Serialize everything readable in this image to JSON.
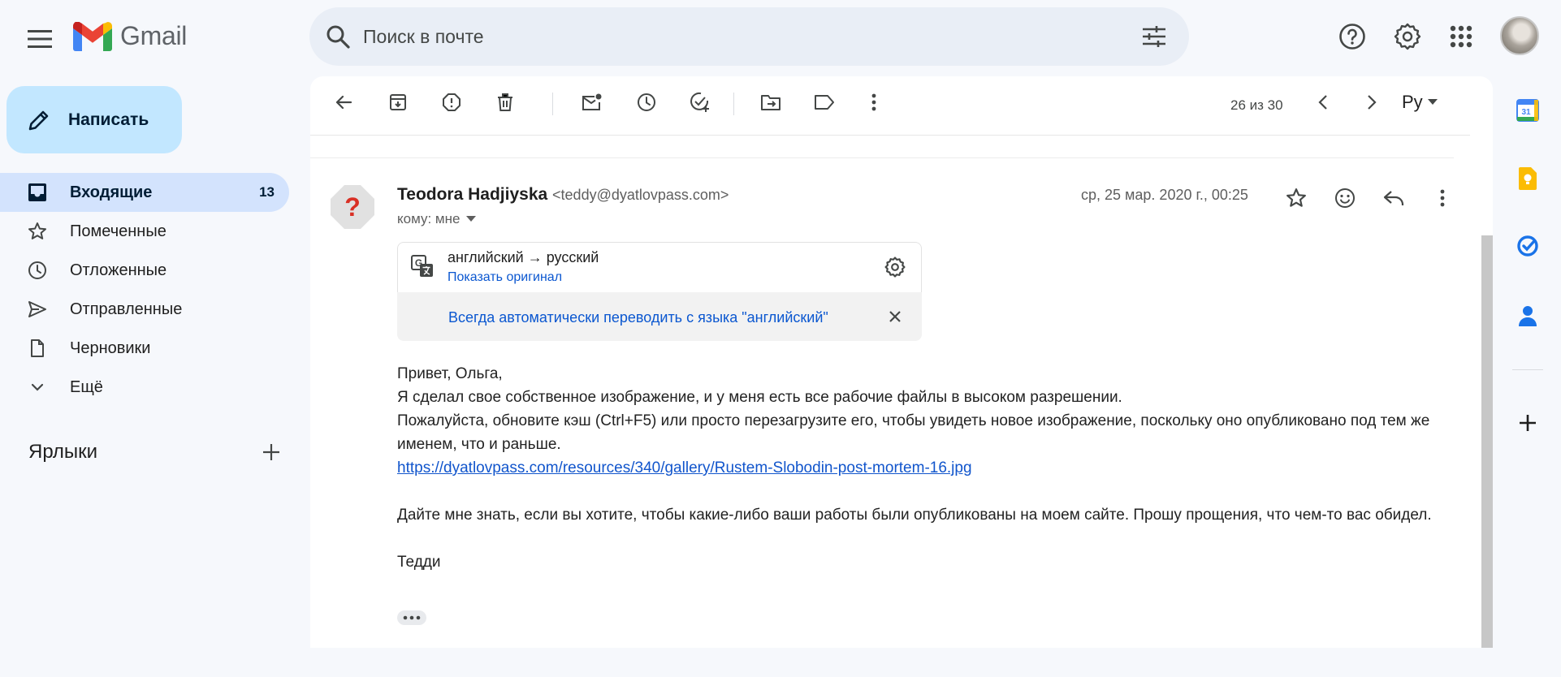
{
  "header": {
    "app_name": "Gmail",
    "search_placeholder": "Поиск в почте"
  },
  "sidebar": {
    "compose_label": "Написать",
    "items": [
      {
        "label": "Входящие",
        "count": "13",
        "icon": "inbox-icon",
        "active": true
      },
      {
        "label": "Помеченные",
        "icon": "star-icon"
      },
      {
        "label": "Отложенные",
        "icon": "clock-icon"
      },
      {
        "label": "Отправленные",
        "icon": "send-icon"
      },
      {
        "label": "Черновики",
        "icon": "draft-icon"
      },
      {
        "label": "Ещё",
        "icon": "chevron-down-icon"
      }
    ],
    "labels_title": "Ярлыки"
  },
  "toolbar": {
    "pager": "26 из 30",
    "lang": "Ру"
  },
  "message": {
    "sender_name": "Teodora Hadjiyska",
    "sender_email": "<teddy@dyatlovpass.com>",
    "to": "кому: мне",
    "date": "ср, 25 мар. 2020 г., 00:25",
    "translation": {
      "lang": "английский → русский",
      "show_original": "Показать оригинал",
      "always": "Всегда автоматически переводить с языка \"английский\""
    },
    "body": {
      "greeting": "Привет, Ольга,",
      "line1": "Я сделал свое собственное изображение, и у меня есть все рабочие файлы в высоком разрешении.",
      "line2": "Пожалуйста, обновите кэш (Ctrl+F5) или просто перезагрузите его, чтобы увидеть новое изображение, поскольку оно опубликовано под тем же именем, что и раньше.",
      "link": "https://dyatlovpass.com/resources/340/gallery/Rustem-Slobodin-post-mortem-16.jpg",
      "line3": "Дайте мне знать, если вы хотите, чтобы какие-либо ваши работы были опубликованы на моем сайте. Прошу прощения, что чем-то вас обидел.",
      "signature": "Тедди"
    }
  },
  "colors": {
    "page_bg": "#f6f8fc",
    "compose_bg": "#c2e7ff",
    "active_nav_bg": "#d3e3fd",
    "link": "#1155cc",
    "accent_blue": "#0b57d0"
  }
}
